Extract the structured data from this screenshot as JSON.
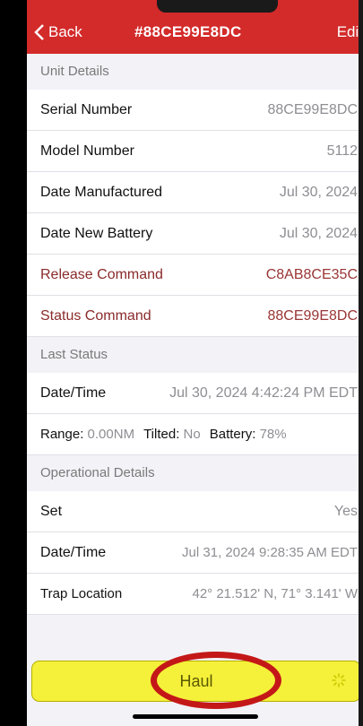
{
  "nav": {
    "back_label": "Back",
    "title": "#88CE99E8DC",
    "edit_label": "Edit"
  },
  "unit_details": {
    "header": "Unit Details",
    "rows": [
      {
        "label": "Serial Number",
        "value": "88CE99E8DC"
      },
      {
        "label": "Model Number",
        "value": "5112"
      },
      {
        "label": "Date Manufactured",
        "value": "Jul 30, 2024"
      },
      {
        "label": "Date New Battery",
        "value": "Jul 30, 2024"
      },
      {
        "label": "Release Command",
        "value": "C8AB8CE35C"
      },
      {
        "label": "Status Command",
        "value": "88CE99E8DC"
      }
    ]
  },
  "last_status": {
    "header": "Last Status",
    "datetime_label": "Date/Time",
    "datetime_value": "Jul 30, 2024 4:42:24 PM EDT",
    "range_label": "Range:",
    "range_value": "0.00NM",
    "tilted_label": "Tilted:",
    "tilted_value": "No",
    "battery_label": "Battery:",
    "battery_value": "78%"
  },
  "operational_details": {
    "header": "Operational Details",
    "set_label": "Set",
    "set_value": "Yes",
    "datetime_label": "Date/Time",
    "datetime_value": "Jul 31, 2024 9:28:35 AM EDT",
    "trap_label": "Trap Location",
    "trap_value": "42° 21.512' N,  71° 3.141' W"
  },
  "haul_button": {
    "label": "Haul"
  },
  "colors": {
    "nav_red": "#d32a2a",
    "haul_yellow": "#f5f03a",
    "highlight_ring": "#c41818"
  }
}
